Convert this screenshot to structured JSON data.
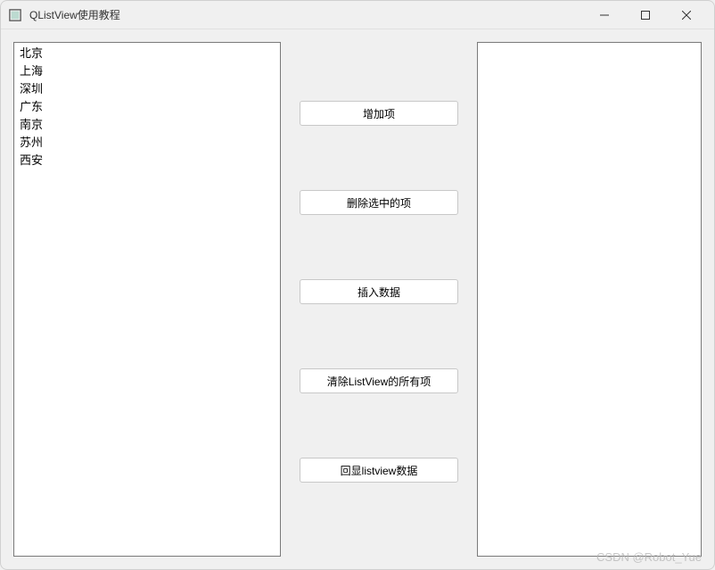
{
  "window": {
    "title": "QListView使用教程"
  },
  "listview": {
    "items": [
      "北京",
      "上海",
      "深圳",
      "广东",
      "南京",
      "苏州",
      "西安"
    ]
  },
  "buttons": {
    "add": "增加项",
    "delete_selected": "删除选中的项",
    "insert": "插入数据",
    "clear_all": "清除ListView的所有项",
    "echo": "回显listview数据"
  },
  "watermark": "CSDN @Robot_Yue"
}
